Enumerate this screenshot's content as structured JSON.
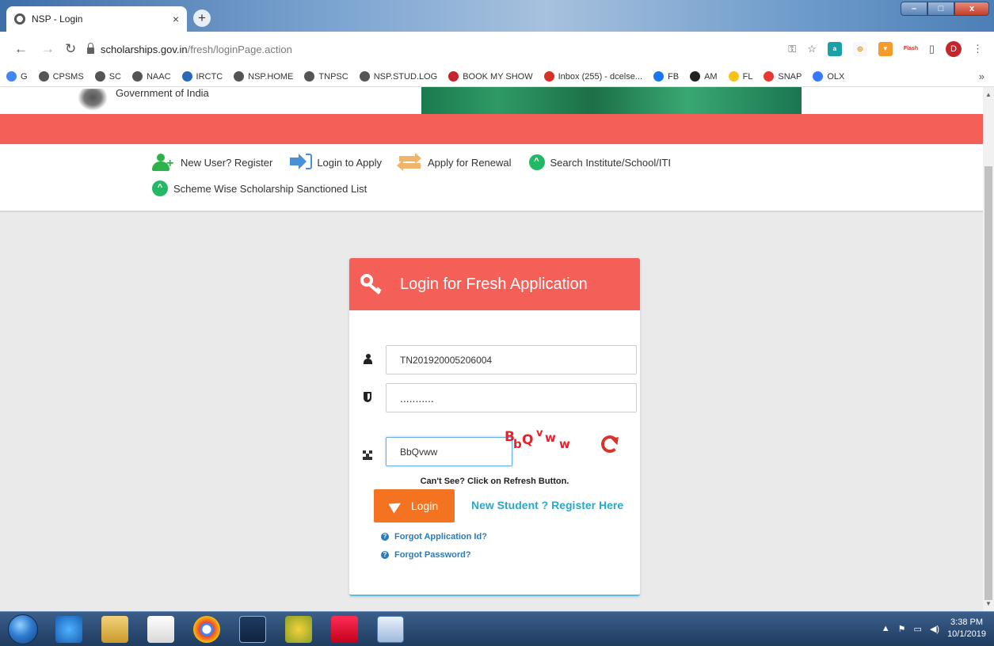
{
  "browser": {
    "tab_title": "NSP - Login",
    "tab_close": "×",
    "new_tab": "+",
    "url_host": "scholarships.gov.in",
    "url_path": "/fresh/loginPage.action",
    "window_controls": {
      "minimize": "–",
      "maximize": "□",
      "close": "x"
    },
    "profile_initial": "D",
    "bookmarks": [
      {
        "label": "G",
        "color": "#4285f4"
      },
      {
        "label": "CPSMS",
        "color": "#555555"
      },
      {
        "label": "SC",
        "color": "#555555"
      },
      {
        "label": "NAAC",
        "color": "#555555"
      },
      {
        "label": "IRCTC",
        "color": "#2a6ab5"
      },
      {
        "label": "NSP.HOME",
        "color": "#555555"
      },
      {
        "label": "TNPSC",
        "color": "#555555"
      },
      {
        "label": "NSP.STUD.LOG",
        "color": "#555555"
      },
      {
        "label": "BOOK MY SHOW",
        "color": "#c4242b"
      },
      {
        "label": "Inbox (255) - dcelse...",
        "color": "#d93025"
      },
      {
        "label": "FB",
        "color": "#1877f2"
      },
      {
        "label": "AM",
        "color": "#222222"
      },
      {
        "label": "FL",
        "color": "#f7c21d"
      },
      {
        "label": "SNAP",
        "color": "#e53935"
      },
      {
        "label": "OLX",
        "color": "#3a77ff"
      }
    ],
    "bookmarks_more": "»"
  },
  "header": {
    "gov_text": "Government of India"
  },
  "nav": {
    "new_user": "New User? Register",
    "login_apply": "Login to Apply",
    "renewal": "Apply for Renewal",
    "search_institute": "Search Institute/School/ITI",
    "scheme_list": "Scheme Wise Scholarship Sanctioned List"
  },
  "login": {
    "title": "Login for Fresh Application",
    "application_id": "TN201920005206004",
    "password_mask": "...........",
    "captcha_input": "BbQvww",
    "captcha_text": "BbQvww",
    "cant_see": "Can't See? Click on Refresh Button.",
    "login_button": "Login",
    "register_link": "New Student ? Register Here",
    "forgot_app_id": "Forgot Application Id?",
    "forgot_password": "Forgot Password?"
  },
  "taskbar": {
    "time": "3:38 PM",
    "date": "10/1/2019"
  },
  "colors": {
    "brand_red": "#f45f58",
    "login_orange": "#f47321",
    "link_teal": "#2aa7c9",
    "accent_green": "#23b866"
  }
}
